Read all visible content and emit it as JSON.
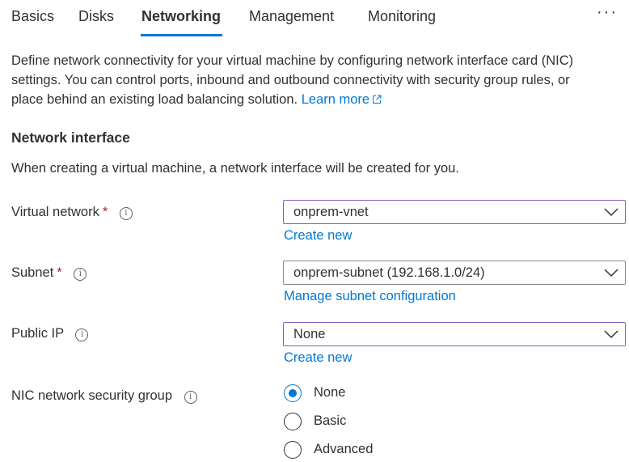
{
  "tabs": [
    {
      "label": "Basics",
      "active": false
    },
    {
      "label": "Disks",
      "active": false
    },
    {
      "label": "Networking",
      "active": true
    },
    {
      "label": "Management",
      "active": false
    },
    {
      "label": "Monitoring",
      "active": false
    }
  ],
  "more_label": "···",
  "intro": {
    "line1": "Define network connectivity for your virtual machine by configuring network interface card (NIC)",
    "line2": "settings. You can control ports, inbound and outbound connectivity with security group rules, or",
    "line3": "place behind an existing load balancing solution.",
    "learn_more": "Learn more"
  },
  "network_interface": {
    "title": "Network interface",
    "description": "When creating a virtual machine, a network interface will be created for you."
  },
  "fields": {
    "virtual_network": {
      "label": "Virtual network",
      "required_mark": "*",
      "value": "onprem-vnet",
      "link": "Create new"
    },
    "subnet": {
      "label": "Subnet",
      "required_mark": "*",
      "value": "onprem-subnet (192.168.1.0/24)",
      "link": "Manage subnet configuration"
    },
    "public_ip": {
      "label": "Public IP",
      "value": "None",
      "link": "Create new"
    },
    "nic_nsg": {
      "label": "NIC network security group",
      "options": [
        "None",
        "Basic",
        "Advanced"
      ],
      "selected": "None"
    }
  },
  "info_glyph": "i",
  "colors": {
    "accent": "#0078d4",
    "required": "#a4262c",
    "focus_border": "#8a5bb4",
    "text": "#323130"
  }
}
